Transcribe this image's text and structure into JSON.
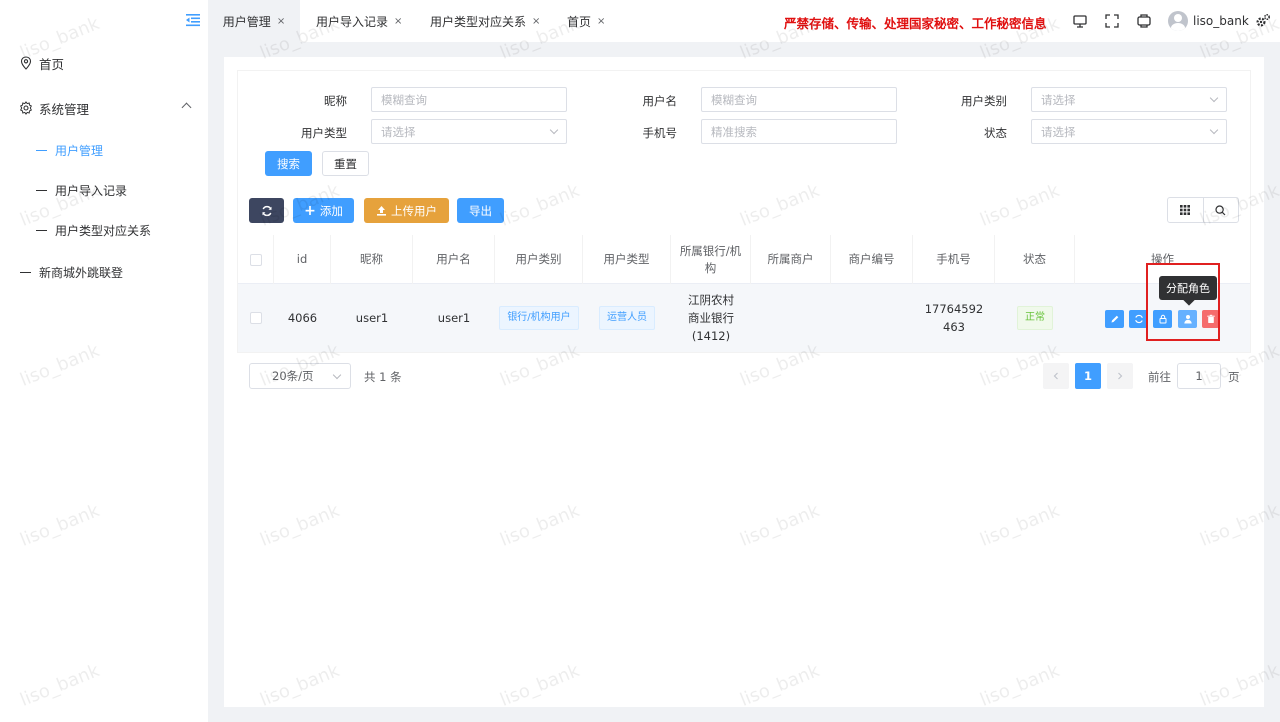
{
  "sidebar": {
    "items": [
      {
        "label": "首页",
        "icon": "location-icon"
      },
      {
        "label": "系统管理",
        "icon": "gear-icon"
      },
      {
        "label": "用户管理"
      },
      {
        "label": "用户导入记录"
      },
      {
        "label": "用户类型对应关系"
      },
      {
        "label": "新商城外跳联登"
      }
    ]
  },
  "header": {
    "tabs": [
      {
        "label": "用户管理"
      },
      {
        "label": "用户导入记录"
      },
      {
        "label": "用户类型对应关系"
      },
      {
        "label": "首页"
      }
    ],
    "close_glyph": "×",
    "warning": "严禁存储、传输、处理国家秘密、工作秘密信息",
    "username": "liso_bank"
  },
  "search": {
    "nickname": {
      "label": "昵称",
      "placeholder": "模糊查询"
    },
    "username": {
      "label": "用户名",
      "placeholder": "模糊查询"
    },
    "user_category": {
      "label": "用户类别",
      "placeholder": "请选择"
    },
    "user_type": {
      "label": "用户类型",
      "placeholder": "请选择"
    },
    "phone": {
      "label": "手机号",
      "placeholder": "精准搜索"
    },
    "status": {
      "label": "状态",
      "placeholder": "请选择"
    },
    "search_btn": "搜索",
    "reset_btn": "重置"
  },
  "toolbar": {
    "add": "添加",
    "upload": "上传用户",
    "export": "导出"
  },
  "table": {
    "columns": [
      "id",
      "昵称",
      "用户名",
      "用户类别",
      "用户类型",
      "所属银行/机构",
      "所属商户",
      "商户编号",
      "手机号",
      "状态",
      "操作"
    ],
    "rows": [
      {
        "id": "4066",
        "nickname": "user1",
        "username": "user1",
        "category": "银行/机构用户",
        "type": "运营人员",
        "bank": "江阴农村商业银行(1412)",
        "merchant": "",
        "merchant_no": "",
        "phone": "17764592463",
        "status": "正常"
      }
    ],
    "tooltip": "分配角色"
  },
  "pagination": {
    "page_size": "20条/页",
    "total": "共 1 条",
    "current": "1",
    "goto_prefix": "前往",
    "goto_value": "1",
    "goto_suffix": "页"
  },
  "watermark": "liso_bank",
  "colors": {
    "primary": "#409eff",
    "warning_text": "#e01010",
    "dark_btn": "#3d4660",
    "upload_btn": "#e6a23c",
    "delete_btn": "#f56c6c"
  }
}
